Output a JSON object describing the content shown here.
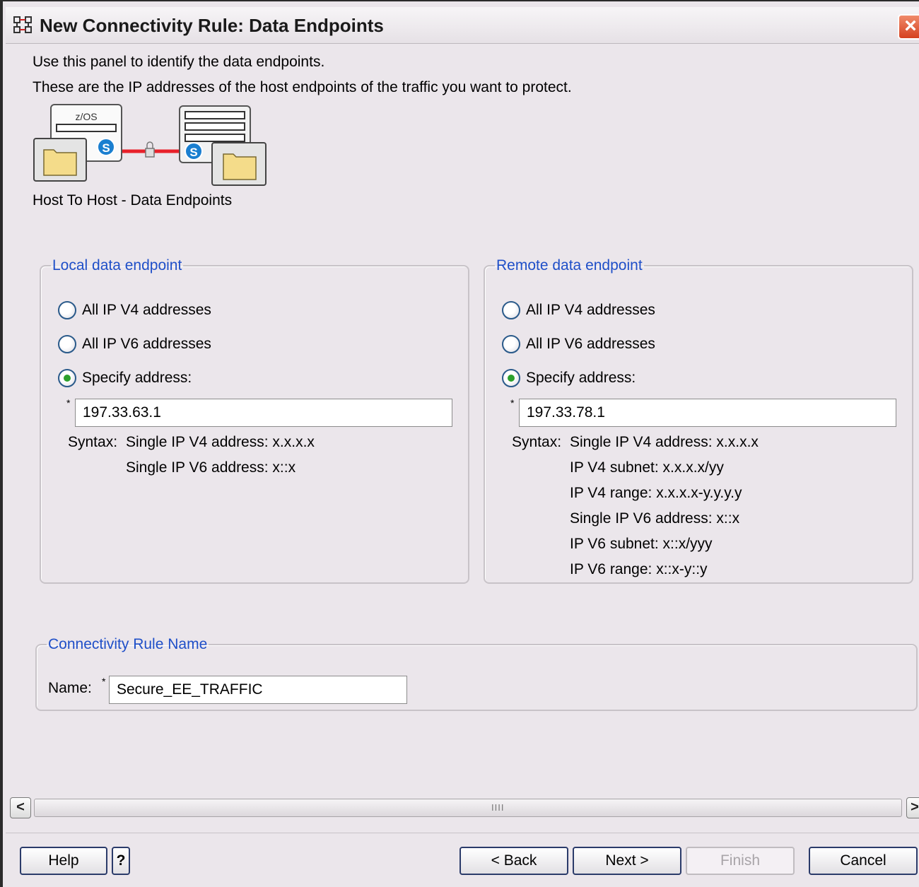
{
  "window": {
    "title": "New Connectivity Rule: Data Endpoints",
    "close_label": "×"
  },
  "intro": {
    "line1": "Use this panel to identify the data endpoints.",
    "line2": "These are the IP addresses of the host endpoints of the traffic you want to protect."
  },
  "illustration": {
    "host_label": "z/OS",
    "badge": "S",
    "caption": "Host To Host - Data Endpoints"
  },
  "local": {
    "legend": "Local data endpoint",
    "options": [
      "All IP V4 addresses",
      "All IP V6 addresses",
      "Specify address:"
    ],
    "selected": "Specify address:",
    "required_mark": "*",
    "address_value": "197.33.63.1",
    "syntax_label": "Syntax:",
    "syntax_lines": [
      "Single IP V4 address: x.x.x.x",
      "Single IP V6 address: x::x"
    ]
  },
  "remote": {
    "legend": "Remote data endpoint",
    "options": [
      "All IP V4 addresses",
      "All IP V6 addresses",
      "Specify address:"
    ],
    "selected": "Specify address:",
    "required_mark": "*",
    "address_value": "197.33.78.1",
    "syntax_label": "Syntax:",
    "syntax_lines": [
      "Single IP V4 address: x.x.x.x",
      "IP V4 subnet: x.x.x.x/yy",
      "IP V4 range: x.x.x.x-y.y.y.y",
      "Single IP V6 address: x::x",
      "IP V6 subnet: x::x/yyy",
      "IP V6 range: x::x-y::y"
    ]
  },
  "rule_name": {
    "legend": "Connectivity Rule Name",
    "label": "Name:",
    "required_mark": "*",
    "value": "Secure_EE_TRAFFIC"
  },
  "scrollbar": {
    "left_arrow": "<",
    "right_arrow": ">",
    "grip": "IIII"
  },
  "buttons": {
    "help": "Help",
    "help_icon": "?",
    "back": "< Back",
    "next": "Next >",
    "finish": "Finish",
    "cancel": "Cancel"
  },
  "colors": {
    "legend_blue": "#1f4fc8",
    "connection_red": "#e8202a",
    "badge_blue": "#1a7fd0",
    "radio_selected_green": "#2ca02c"
  }
}
